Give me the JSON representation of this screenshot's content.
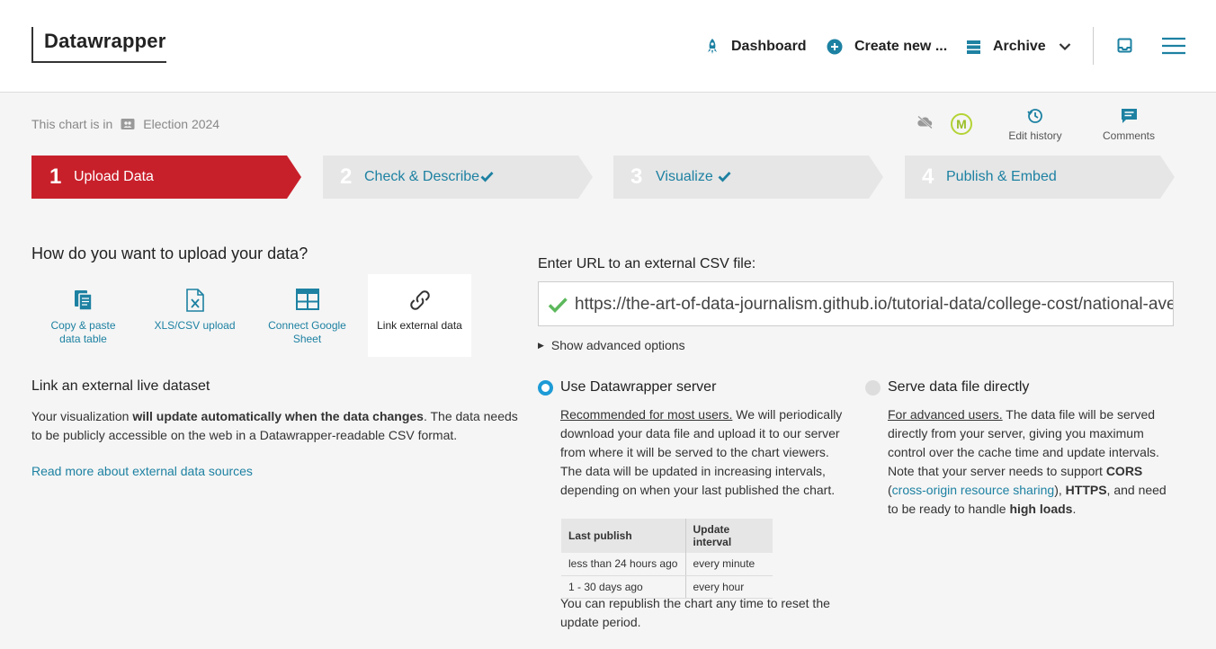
{
  "header": {
    "logo": "Datawrapper",
    "nav": {
      "dashboard": "Dashboard",
      "create_new": "Create new ...",
      "archive": "Archive"
    }
  },
  "breadcrumb": {
    "prefix": "This chart is in",
    "folder": "Election 2024"
  },
  "tools": {
    "avatar_initial": "M",
    "edit_history": "Edit history",
    "comments": "Comments"
  },
  "steps": [
    {
      "num": "1",
      "label": "Upload Data",
      "check": false
    },
    {
      "num": "2",
      "label": "Check & Describe",
      "check": true
    },
    {
      "num": "3",
      "label": "Visualize",
      "check": true
    },
    {
      "num": "4",
      "label": "Publish & Embed",
      "check": false
    }
  ],
  "upload": {
    "title": "How do you want to upload your data?",
    "options": [
      {
        "line1": "Copy & paste",
        "line2": "data table"
      },
      {
        "line1": "XLS/CSV upload",
        "line2": ""
      },
      {
        "line1": "Connect Google",
        "line2": "Sheet"
      },
      {
        "line1": "Link external data",
        "line2": ""
      }
    ],
    "subtitle": "Link an external live dataset",
    "para_a": "Your visualization ",
    "para_bold": "will update automatically when the data changes",
    "para_b": ". The data needs to be publicly accessible on the web in a Datawrapper-readable CSV format.",
    "read_more": "Read more about external data sources"
  },
  "external": {
    "url_label": "Enter URL to an external CSV file:",
    "url_value": "https://the-art-of-data-journalism.github.io/tutorial-data/college-cost/national-average.csv",
    "advanced": "Show advanced options",
    "server": {
      "label": "Use Datawrapper server",
      "lead": "Recommended for most users.",
      "text": " We will periodically download your data file and upload it to our server from where it will be served to the chart viewers. The data will be updated in increasing intervals, depending on when your last published the chart."
    },
    "direct": {
      "label": "Serve data file directly",
      "lead": "For advanced users.",
      "text_a": " The data file will be served directly from your server, giving you maximum control over the cache time and update intervals. Note that your server needs to support ",
      "cors": "CORS",
      "paren_open": " (",
      "cors_link": "cross-origin resource sharing",
      "paren_close": "), ",
      "https": "HTTPS",
      "text_b": ", and need to be ready to handle ",
      "loads": "high loads",
      "text_c": "."
    },
    "table": {
      "headers": [
        "Last publish",
        "Update interval"
      ],
      "rows": [
        [
          "less than 24 hours ago",
          "every minute"
        ],
        [
          "1 - 30 days ago",
          "every hour"
        ]
      ]
    },
    "republish": "You can republish the chart any time to reset the update period."
  },
  "colors": {
    "active_step": "#c8202b",
    "inactive_step": "#e6e6e6",
    "link": "#1d81a2",
    "radio": "#1d9bd6",
    "check": "#5cb85c"
  }
}
